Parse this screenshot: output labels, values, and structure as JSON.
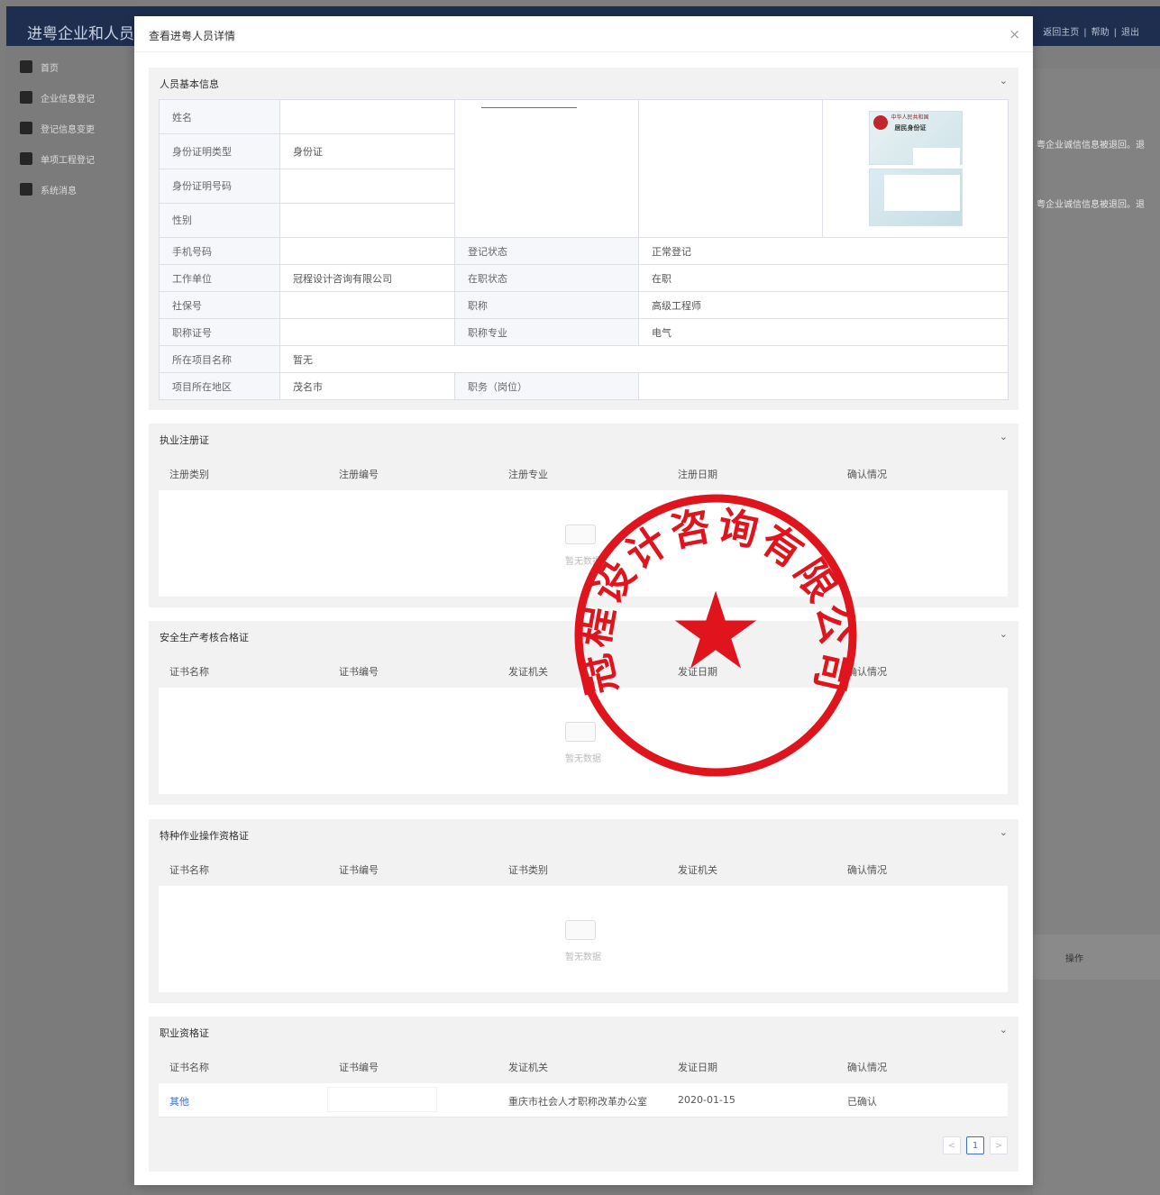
{
  "app": {
    "title": "进粤企业和人员诚",
    "top_links": [
      "返回主页",
      "帮助",
      "退出"
    ]
  },
  "sidebar": {
    "items": [
      {
        "label": "首页",
        "icon": "home-icon"
      },
      {
        "label": "企业信息登记",
        "icon": "building-icon"
      },
      {
        "label": "登记信息变更",
        "icon": "edit-icon"
      },
      {
        "label": "单项工程登记",
        "icon": "clipboard-icon"
      },
      {
        "label": "系统消息",
        "icon": "message-icon"
      }
    ]
  },
  "background": {
    "msg1": "粤企业诚信信息被退回。退",
    "msg2": "粤企业诚信信息被退回。退",
    "op_label": "操作"
  },
  "modal": {
    "title": "查看进粤人员详情",
    "close": "×"
  },
  "basic_info": {
    "title": "人员基本信息",
    "rows": {
      "name_label": "姓名",
      "id_type_label": "身份证明类型",
      "id_type_value": "身份证",
      "id_number_label": "身份证明号码",
      "gender_label": "性别",
      "phone_label": "手机号码",
      "reg_status_label": "登记状态",
      "reg_status_value": "正常登记",
      "employer_label": "工作单位",
      "employer_value": "冠程设计咨询有限公司",
      "job_status_label": "在职状态",
      "job_status_value": "在职",
      "social_no_label": "社保号",
      "title_label": "职称",
      "title_value": "高级工程师",
      "title_cert_label": "职称证号",
      "title_major_label": "职称专业",
      "title_major_value": "电气",
      "project_name_label": "所在项目名称",
      "project_name_value": "暂无",
      "project_region_label": "项目所在地区",
      "project_region_value": "茂名市",
      "position_label": "职务（岗位）"
    },
    "id_card": {
      "country": "中华人民共和国",
      "name": "居民身份证"
    }
  },
  "practice_cert": {
    "title": "执业注册证",
    "columns": [
      "注册类别",
      "注册编号",
      "注册专业",
      "注册日期",
      "确认情况"
    ],
    "empty_text": "暂无数据"
  },
  "safety_cert": {
    "title": "安全生产考核合格证",
    "columns": [
      "证书名称",
      "证书编号",
      "发证机关",
      "发证日期",
      "确认情况"
    ],
    "empty_text": "暂无数据"
  },
  "special_cert": {
    "title": "特种作业操作资格证",
    "columns": [
      "证书名称",
      "证书编号",
      "证书类别",
      "发证机关",
      "确认情况"
    ],
    "empty_text": "暂无数据"
  },
  "qualification_cert": {
    "title": "职业资格证",
    "columns": [
      "证书名称",
      "证书编号",
      "发证机关",
      "发证日期",
      "确认情况"
    ],
    "rows": [
      {
        "name": "其他",
        "number": "",
        "issuer": "重庆市社会人才职称改革办公室",
        "date": "2020-01-15",
        "status": "已确认"
      }
    ],
    "pager": {
      "prev": "<",
      "current": "1",
      "next": ">"
    }
  },
  "seal": {
    "text": "冠程设计咨询有限公司",
    "star": "★",
    "color": "#e0141c"
  },
  "colors": {
    "header_bg": "#1e2e4f",
    "link": "#3c6ed6",
    "section_bg": "#f2f2f2"
  }
}
